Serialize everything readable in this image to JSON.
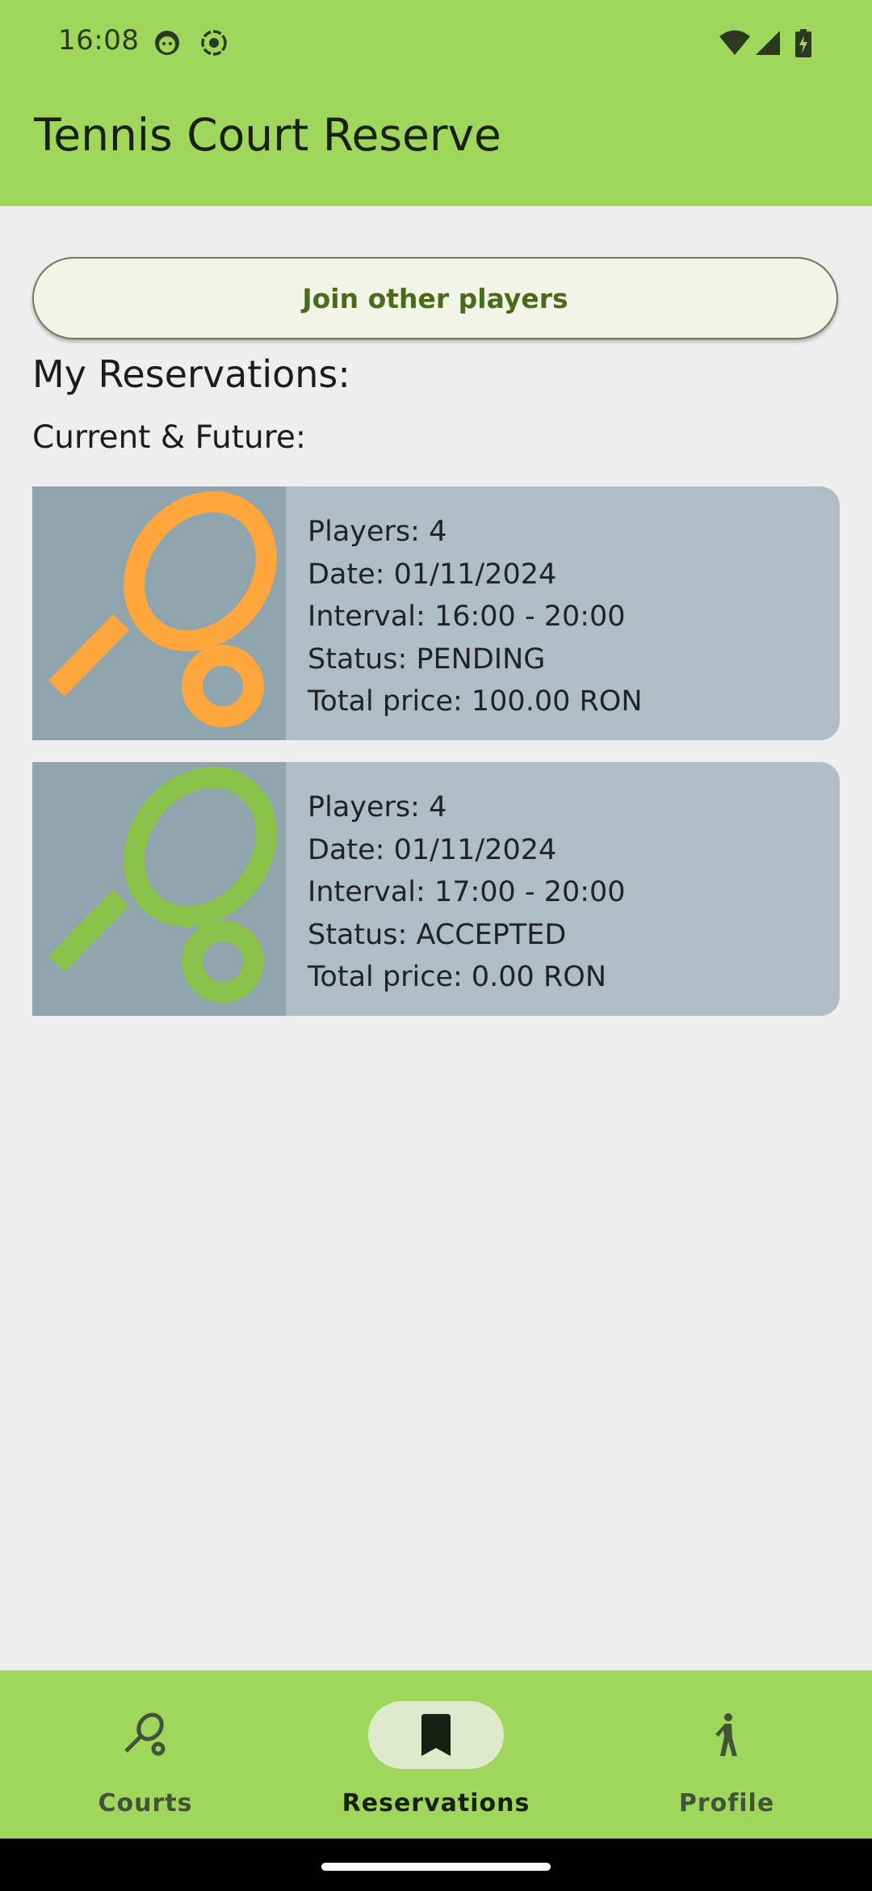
{
  "status_bar": {
    "time": "16:08",
    "icons": [
      "face-icon",
      "record-icon",
      "wifi-icon",
      "cell-signal-icon",
      "battery-charging-icon"
    ]
  },
  "app_bar": {
    "title": "Tennis Court Reserve"
  },
  "join_button": {
    "label": "Join other players"
  },
  "reservations": {
    "title": "My Reservations:",
    "subtitle": "Current & Future:",
    "items": [
      {
        "players": "Players: 4",
        "date": "Date: 01/11/2024",
        "interval": "Interval: 16:00 - 20:00",
        "status": "Status: PENDING",
        "price": "Total price: 100.00 RON",
        "icon": "tennis-racket-ball-icon",
        "icon_color": "#ffa73d"
      },
      {
        "players": "Players: 4",
        "date": "Date: 01/11/2024",
        "interval": "Interval: 17:00 - 20:00",
        "status": "Status: ACCEPTED",
        "price": "Total price: 0.00 RON",
        "icon": "tennis-racket-ball-icon",
        "icon_color": "#8bc34a"
      }
    ]
  },
  "bottom_nav": {
    "items": [
      {
        "label": "Courts",
        "icon": "tennis-racket-icon",
        "active": false
      },
      {
        "label": "Reservations",
        "icon": "bookmark-icon",
        "active": true
      },
      {
        "label": "Profile",
        "icon": "person-walking-icon",
        "active": false
      }
    ]
  },
  "colors": {
    "header": "#9fd75d",
    "background": "#eeeeee",
    "card": "#afbec5",
    "card_thumb": "#90a4ae",
    "button_text": "#4a6b1a",
    "nav_indicator": "#dfe9cc"
  }
}
